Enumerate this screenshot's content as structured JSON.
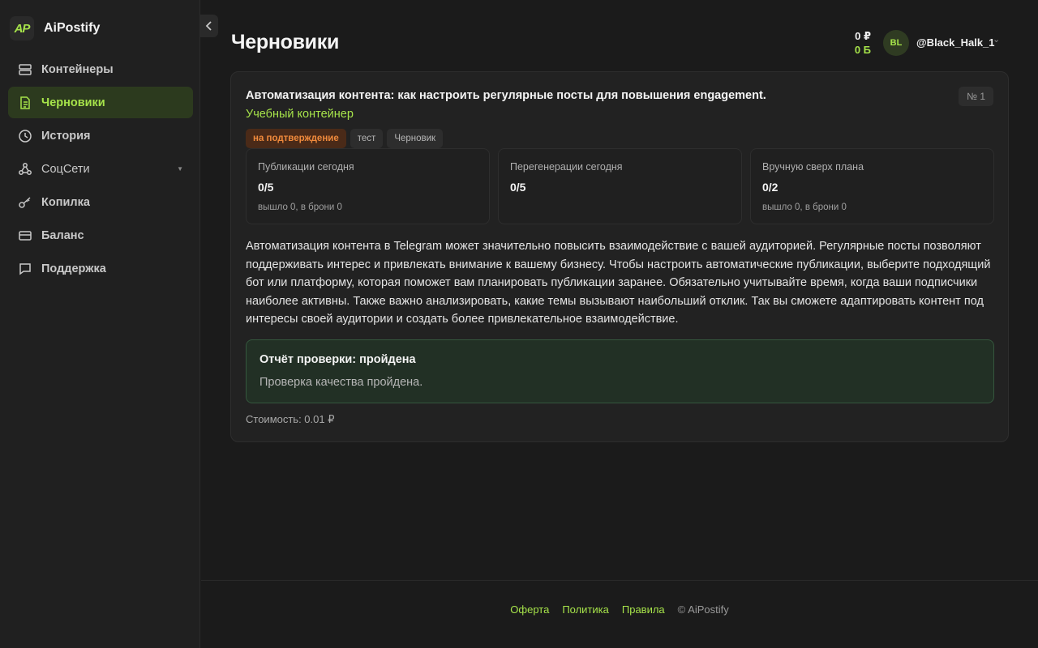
{
  "app": {
    "name": "AiPostify",
    "logo_text": "AP"
  },
  "sidebar": {
    "items": [
      {
        "label": "Контейнеры",
        "icon": "server-icon",
        "active": false
      },
      {
        "label": "Черновики",
        "icon": "document-icon",
        "active": true
      },
      {
        "label": "История",
        "icon": "clock-icon",
        "active": false
      },
      {
        "label": "СоцСети",
        "icon": "share-icon",
        "active": false,
        "has_caret": true
      },
      {
        "label": "Копилка",
        "icon": "key-icon",
        "active": false
      },
      {
        "label": "Баланс",
        "icon": "wallet-icon",
        "active": false
      },
      {
        "label": "Поддержка",
        "icon": "chat-icon",
        "active": false
      }
    ]
  },
  "header": {
    "title": "Черновики",
    "balance_rub": "0 ₽",
    "balance_b": "0 Б",
    "avatar_initials": "BL",
    "username": "@Black_Halk_1"
  },
  "draft": {
    "title": "Автоматизация контента: как настроить регулярные посты для повышения engagement.",
    "number": "№ 1",
    "container": "Учебный контейнер",
    "tags": [
      "на подтверждение",
      "тест",
      "Черновик"
    ],
    "stats": [
      {
        "label": "Публикации сегодня",
        "value": "0/5",
        "sub": "вышло 0, в брони 0"
      },
      {
        "label": "Перегенерации сегодня",
        "value": "0/5",
        "sub": ""
      },
      {
        "label": "Вручную сверх плана",
        "value": "0/2",
        "sub": "вышло 0, в брони 0"
      }
    ],
    "body": "Автоматизация контента в Telegram может значительно повысить взаимодействие с вашей аудиторией. Регулярные посты позволяют поддерживать интерес и привлекать внимание к вашему бизнесу. Чтобы настроить автоматические публикации, выберите подходящий бот или платформу, которая поможет вам планировать публикации заранее. Обязательно учитывайте время, когда ваши подписчики наиболее активны. Также важно анализировать, какие темы вызывают наибольший отклик. Так вы сможете адаптировать контент под интересы своей аудитории и создать более привлекательное взаимодействие.",
    "report_title": "Отчёт проверки: пройдена",
    "report_text": "Проверка качества пройдена.",
    "cost": "Стоимость: 0.01 ₽"
  },
  "footer": {
    "links": [
      "Оферта",
      "Политика",
      "Правила"
    ],
    "copyright": "© AiPostify"
  },
  "colors": {
    "accent": "#a6e34a",
    "tag_orange": "#f08a3c",
    "background": "#1b1b1b"
  }
}
